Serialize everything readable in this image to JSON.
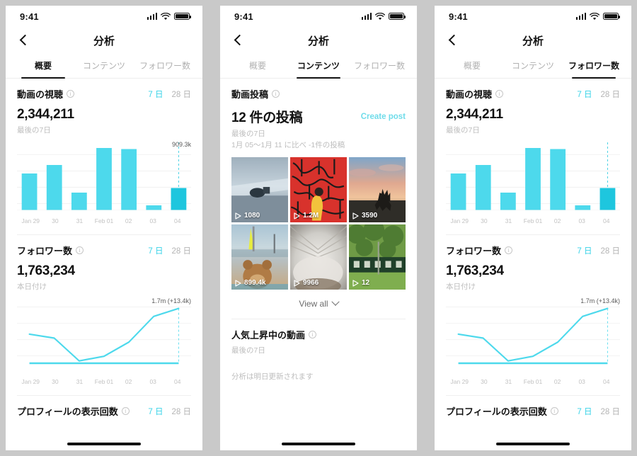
{
  "colors": {
    "accent": "#3ad3e8",
    "bar": "#4dd9ec",
    "bar_highlight": "#1ec6de",
    "line": "#4dd9ec",
    "link": "#6fdcea",
    "text": "#111111",
    "muted": "#bdbdbd"
  },
  "status_bar": {
    "time": "9:41",
    "signal_icon": "signal-bars-icon",
    "wifi_icon": "wifi-icon",
    "battery_icon": "battery-full-icon"
  },
  "nav": {
    "back_icon": "chevron-left-icon",
    "title": "分析"
  },
  "tabs": [
    {
      "id": "overview",
      "label": "概要"
    },
    {
      "id": "content",
      "label": "コンテンツ"
    },
    {
      "id": "followers",
      "label": "フォロワー数"
    }
  ],
  "panels": [
    {
      "id": "panel-overview",
      "active_tab": "overview"
    },
    {
      "id": "panel-content",
      "active_tab": "content"
    },
    {
      "id": "panel-followers",
      "active_tab": "followers"
    }
  ],
  "range_toggle": {
    "seven": "7 日",
    "twentyeight": "28 日",
    "selected": "7 日"
  },
  "video_views_section": {
    "title": "動画の視聴",
    "info_icon": "info-icon",
    "value": "2,344,211",
    "subtext": "最後の7日",
    "peak_label": "909.3k"
  },
  "followers_section": {
    "title": "フォロワー数",
    "info_icon": "info-icon",
    "value": "1,763,234",
    "subtext": "本日付け",
    "peak_label": "1.7m (+13.4k)"
  },
  "profile_views_section": {
    "title": "プロフィールの表示回数",
    "info_icon": "info-icon"
  },
  "content_tab": {
    "posts_header": {
      "title": "動画投稿",
      "info_icon": "info-icon"
    },
    "posts_count": "12 件の投稿",
    "create_post_label": "Create post",
    "subtext_line1": "最後の7日",
    "subtext_line2": "1月 05〜1月 11 に比べ -1件の投稿",
    "videos": [
      {
        "views": "1080",
        "play_icon": "play-icon",
        "alt": "skateboarder-ramp-thumbnail"
      },
      {
        "views": "1.2M",
        "play_icon": "play-icon",
        "alt": "red-graffiti-wall-thumbnail"
      },
      {
        "views": "3590",
        "play_icon": "play-icon",
        "alt": "deer-sunset-thumbnail"
      },
      {
        "views": "899.4k",
        "play_icon": "play-icon",
        "alt": "teddy-bear-beach-thumbnail"
      },
      {
        "views": "9966",
        "play_icon": "play-icon",
        "alt": "blurred-tunnel-thumbnail"
      },
      {
        "views": "12",
        "play_icon": "play-icon",
        "alt": "green-train-carriage-thumbnail"
      }
    ],
    "view_all_label": "View all",
    "view_all_icon": "chevron-down-icon",
    "trending_section": {
      "title": "人気上昇中の動画",
      "info_icon": "info-icon",
      "subtext": "最後の7日",
      "empty_message": "分析は明日更新されます"
    }
  },
  "chart_data": [
    {
      "type": "bar",
      "title": "動画の視聴",
      "categories": [
        "Jan 29",
        "30",
        "31",
        "Feb 01",
        "02",
        "03",
        "04"
      ],
      "values": [
        520,
        640,
        250,
        880,
        865,
        70,
        315
      ],
      "peak_label": "909.3k",
      "highlight_index": 6,
      "ylim": [
        0,
        920
      ],
      "xlabel": "",
      "ylabel": "",
      "grid": true,
      "legend": "none"
    },
    {
      "type": "line",
      "title": "フォロワー数",
      "categories": [
        "Jan 29",
        "30",
        "31",
        "Feb 01",
        "02",
        "03",
        "04"
      ],
      "values": [
        430,
        370,
        25,
        95,
        310,
        700,
        820
      ],
      "peak_label": "1.7m (+13.4k)",
      "ylim": [
        0,
        880
      ],
      "xlabel": "",
      "ylabel": "",
      "grid": true,
      "legend": "none"
    }
  ]
}
